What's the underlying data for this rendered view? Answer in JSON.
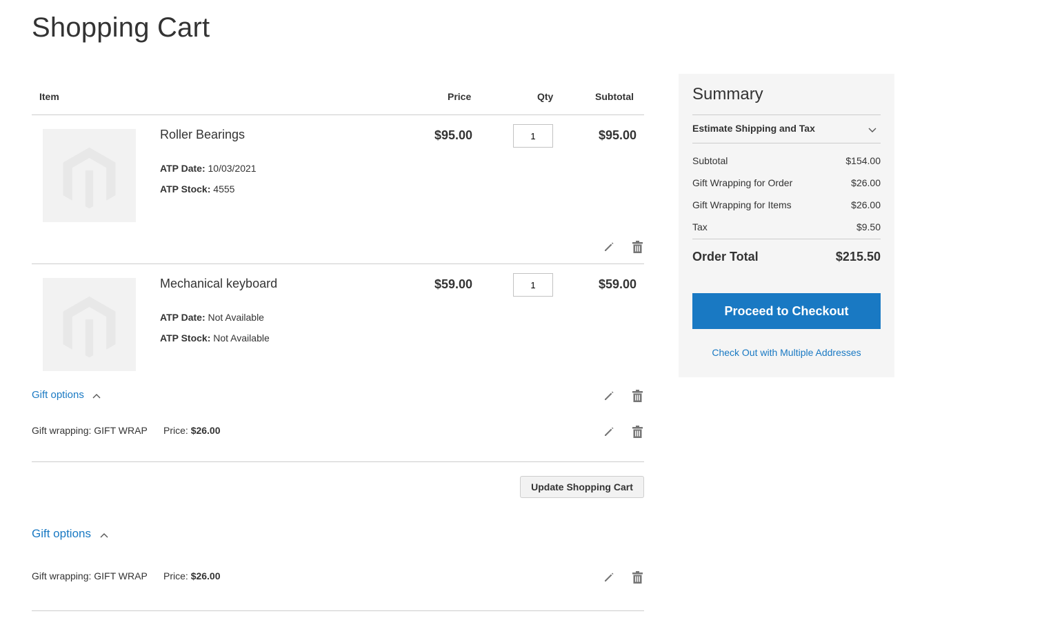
{
  "page": {
    "title": "Shopping Cart"
  },
  "cart": {
    "headers": {
      "item": "Item",
      "price": "Price",
      "qty": "Qty",
      "subtotal": "Subtotal"
    },
    "items": [
      {
        "name": "Roller Bearings",
        "price": "$95.00",
        "qty": "1",
        "subtotal": "$95.00",
        "atp_date_label": "ATP Date:",
        "atp_date": "10/03/2021",
        "atp_stock_label": "ATP Stock:",
        "atp_stock": "4555"
      },
      {
        "name": "Mechanical keyboard",
        "price": "$59.00",
        "qty": "1",
        "subtotal": "$59.00",
        "atp_date_label": "ATP Date:",
        "atp_date": "Not Available",
        "atp_stock_label": "ATP Stock:",
        "atp_stock": "Not Available",
        "gift_options_label": "Gift options",
        "gift_wrapping": "Gift wrapping: GIFT WRAP",
        "gift_price_label": "Price:",
        "gift_price": "$26.00"
      }
    ],
    "update_button": "Update Shopping Cart",
    "order_gift": {
      "label": "Gift options",
      "wrapping": "Gift wrapping: GIFT WRAP",
      "price_label": "Price:",
      "price": "$26.00"
    }
  },
  "summary": {
    "title": "Summary",
    "estimate": "Estimate Shipping and Tax",
    "rows": [
      {
        "label": "Subtotal",
        "value": "$154.00"
      },
      {
        "label": "Gift Wrapping for Order",
        "value": "$26.00"
      },
      {
        "label": "Gift Wrapping for Items",
        "value": "$26.00"
      },
      {
        "label": "Tax",
        "value": "$9.50"
      }
    ],
    "total_label": "Order Total",
    "total_value": "$215.50",
    "checkout_button": "Proceed to Checkout",
    "multi_address_link": "Check Out with Multiple Addresses"
  },
  "colors": {
    "accent": "#1979c3",
    "placeholder_bg": "#f2f2f2",
    "summary_bg": "#f5f5f5"
  }
}
